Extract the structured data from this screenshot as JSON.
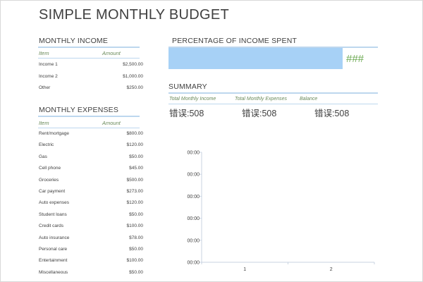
{
  "page": {
    "title": "SIMPLE MONTHLY BUDGET"
  },
  "income": {
    "heading": "MONTHLY INCOME",
    "col_item": "Item",
    "col_amount": "Amount",
    "rows": [
      {
        "item": "Income 1",
        "amount": "$2,500.00"
      },
      {
        "item": "Income 2",
        "amount": "$1,000.00"
      },
      {
        "item": "Other",
        "amount": "$250.00"
      }
    ]
  },
  "expenses": {
    "heading": "MONTHLY EXPENSES",
    "col_item": "Item",
    "col_amount": "Amount",
    "rows": [
      {
        "item": "Rent/mortgage",
        "amount": "$800.00"
      },
      {
        "item": "Electric",
        "amount": "$120.00"
      },
      {
        "item": "Gas",
        "amount": "$50.00"
      },
      {
        "item": "Cell phone",
        "amount": "$45.00"
      },
      {
        "item": "Groceries",
        "amount": "$500.00"
      },
      {
        "item": "Car payment",
        "amount": "$273.00"
      },
      {
        "item": "Auto expenses",
        "amount": "$120.00"
      },
      {
        "item": "Student loans",
        "amount": "$50.00"
      },
      {
        "item": "Credit cards",
        "amount": "$100.00"
      },
      {
        "item": "Auto insurance",
        "amount": "$78.00"
      },
      {
        "item": "Personal care",
        "amount": "$50.00"
      },
      {
        "item": "Entertainment",
        "amount": "$100.00"
      },
      {
        "item": "Miscellaneous",
        "amount": "$50.00"
      }
    ]
  },
  "percent": {
    "heading": "PERCENTAGE OF INCOME SPENT",
    "value": "###",
    "bar_color": "#a7d1f6",
    "value_color": "#6aa84f"
  },
  "summary": {
    "heading": "SUMMARY",
    "col_total_income": "Total Monthly Income",
    "col_total_expenses": "Total Monthly Expenses",
    "col_balance": "Balance",
    "total_income": "错误:508",
    "total_expenses": "错误:508",
    "balance": "错误:508"
  },
  "chart_data": {
    "type": "bar",
    "categories": [
      "1",
      "2"
    ],
    "y_tick_labels": [
      "00:00",
      "00:00",
      "00:00",
      "00:00",
      "00:00",
      "00:00"
    ],
    "series": [],
    "title": "",
    "xlabel": "",
    "ylabel": "",
    "grid": false,
    "axis_color": "#c9d3e0"
  }
}
